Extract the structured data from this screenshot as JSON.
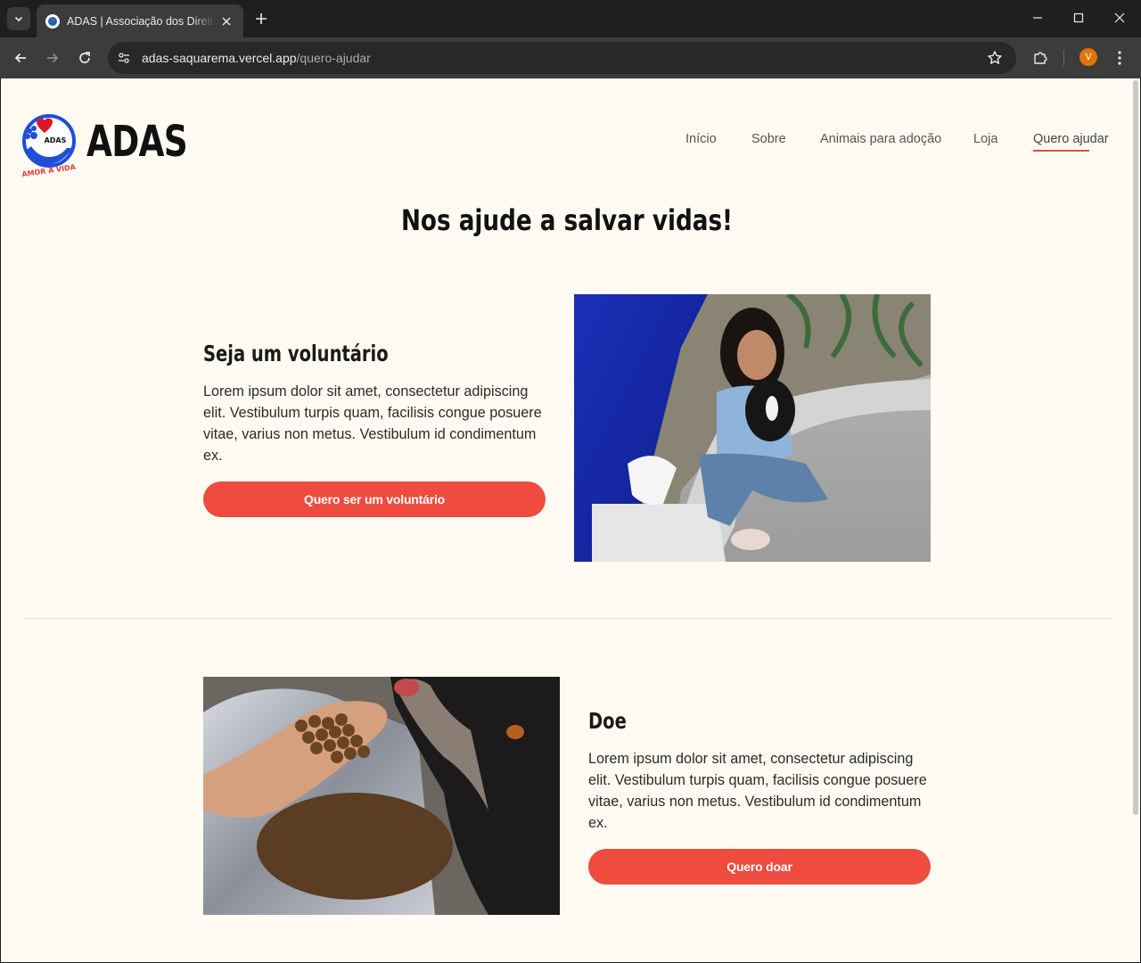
{
  "browser": {
    "tab_title": "ADAS | Associação dos Direitos",
    "url_domain": "adas-saquarema.vercel.app",
    "url_path": "/quero-ajudar",
    "profile_initial": "V"
  },
  "site": {
    "brand": "ADAS",
    "logo_text": "ADAS",
    "logo_tagline": "AMOR À VIDA",
    "nav": [
      "Início",
      "Sobre",
      "Animais para adoção",
      "Loja",
      "Quero ajudar"
    ],
    "active_nav": "Quero ajudar"
  },
  "page": {
    "headline": "Nos ajude a salvar vidas!",
    "sections": [
      {
        "title": "Seja um voluntário",
        "text": "Lorem ipsum dolor sit amet, consectetur adipiscing elit. Vestibulum turpis quam, facilisis congue posuere vitae, varius non metus. Vestibulum id condimentum ex.",
        "button": "Quero ser um voluntário",
        "image": "volunteer-with-puppy-photo"
      },
      {
        "title": "Doe",
        "text": "Lorem ipsum dolor sit amet, consectetur adipiscing elit. Vestibulum turpis quam, facilisis congue posuere vitae, varius non metus. Vestibulum id condimentum ex.",
        "button": "Quero doar",
        "image": "dog-food-donation-photo"
      }
    ]
  },
  "colors": {
    "accent": "#ef4b3f",
    "page_background": "#fffbf3",
    "heading": "#111111"
  }
}
